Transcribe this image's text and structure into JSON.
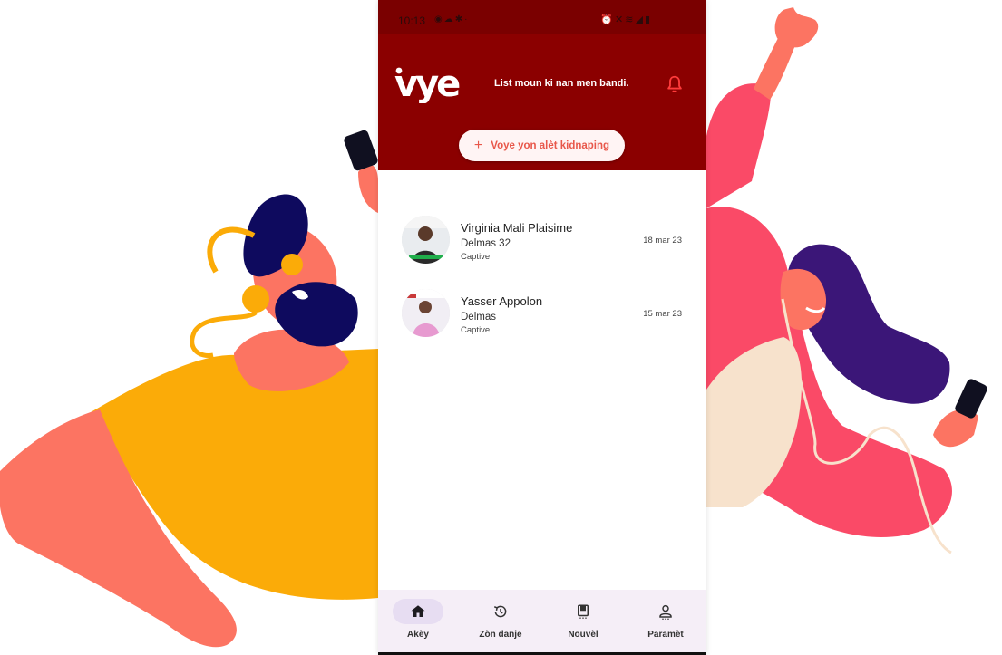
{
  "status_bar": {
    "time": "10:13",
    "left_icons": [
      "messenger-icon",
      "cloud-icon",
      "settings-icon",
      "dot-icon"
    ],
    "right_icons": [
      "alarm-icon",
      "mute-icon",
      "wifi-icon",
      "signal-icon",
      "battery-icon"
    ]
  },
  "header": {
    "logo_text": "vye",
    "tagline": "List moun ki nan men bandi.",
    "bell_icon": "bell-icon"
  },
  "alert_button": {
    "icon": "plus-icon",
    "label": "Voye yon alèt kidnaping"
  },
  "victims": [
    {
      "name": "Virginia Mali Plaisime",
      "zone": "Delmas 32",
      "status": "Captive",
      "date": "18 mar 23"
    },
    {
      "name": "Yasser Appolon",
      "zone": "Delmas",
      "status": "Captive",
      "date": "15 mar 23"
    }
  ],
  "bottom_nav": [
    {
      "icon": "home-icon",
      "label": "Akèy",
      "active": true
    },
    {
      "icon": "history-icon",
      "label": "Zòn danje",
      "active": false
    },
    {
      "icon": "book-icon",
      "label": "Nouvèl",
      "active": false
    },
    {
      "icon": "profile-icon",
      "label": "Paramèt",
      "active": false
    }
  ],
  "colors": {
    "header": "#8b0000",
    "accent": "#e8574a",
    "nav_background": "#f5eef7",
    "nav_active": "#e7ddf2"
  }
}
